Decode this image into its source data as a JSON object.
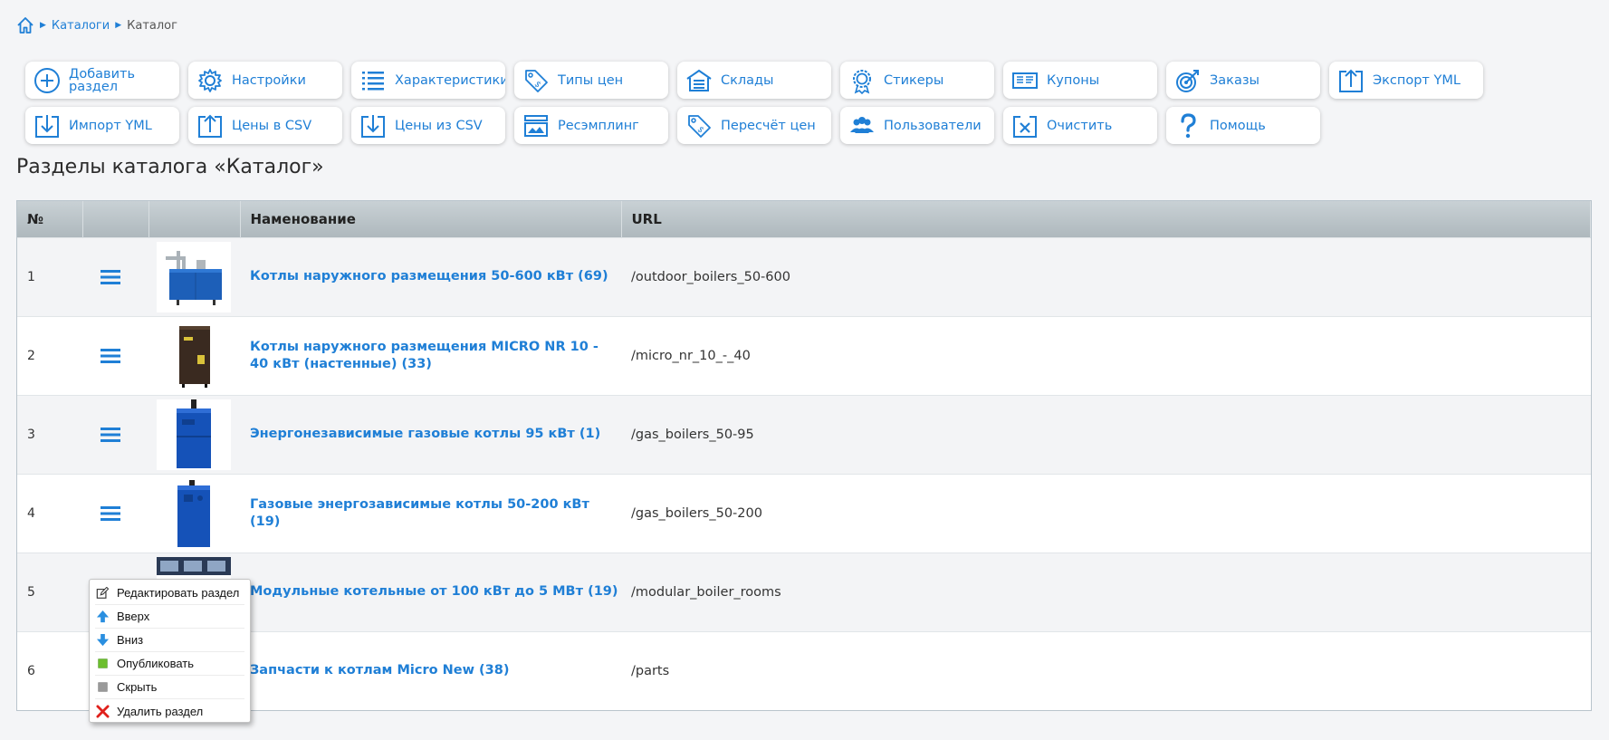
{
  "breadcrumb": {
    "items": [
      {
        "label": "Каталоги"
      },
      {
        "label": "Каталог"
      }
    ]
  },
  "toolbar": {
    "buttons": [
      {
        "label": "Добавить\nраздел",
        "icon": "plus-circle-icon"
      },
      {
        "label": "Настройки",
        "icon": "gear-icon"
      },
      {
        "label": "Характеристики",
        "icon": "list-icon"
      },
      {
        "label": "Типы цен",
        "icon": "price-tag-icon"
      },
      {
        "label": "Склады",
        "icon": "warehouse-icon"
      },
      {
        "label": "Стикеры",
        "icon": "badge-icon"
      },
      {
        "label": "Купоны",
        "icon": "coupon-icon"
      },
      {
        "label": "Заказы",
        "icon": "target-icon"
      },
      {
        "label": "Экспорт YML",
        "icon": "export-icon"
      },
      {
        "label": "Импорт YML",
        "icon": "import-icon"
      },
      {
        "label": "Цены в CSV",
        "icon": "upload-icon"
      },
      {
        "label": "Цены из CSV",
        "icon": "download-icon"
      },
      {
        "label": "Ресэмплинг",
        "icon": "resample-icon"
      },
      {
        "label": "Пересчёт цен",
        "icon": "price-recalc-icon"
      },
      {
        "label": "Пользователи",
        "icon": "users-icon"
      },
      {
        "label": "Очистить",
        "icon": "clear-icon"
      },
      {
        "label": "Помощь",
        "icon": "help-icon"
      }
    ]
  },
  "page_title": "Разделы каталога «Каталог»",
  "table": {
    "columns": [
      "№",
      "",
      "",
      "Наменование",
      "URL"
    ],
    "rows": [
      {
        "num": "1",
        "name": "Котлы наружного размещения 50-600 кВт (69)",
        "url": "/outdoor_boilers_50-600",
        "thumb": "boiler-outdoor"
      },
      {
        "num": "2",
        "name": "Котлы наружного размещения MICRO NR 10 - 40 кВт (настенные) (33)",
        "url": "/micro_nr_10_-_40",
        "thumb": "boiler-micro"
      },
      {
        "num": "3",
        "name": "Энергонезависимые газовые котлы 95 кВт (1)",
        "url": "/gas_boilers_50-95",
        "thumb": "boiler-blue"
      },
      {
        "num": "4",
        "name": "Газовые энергозависимые котлы 50-200 кВт (19)",
        "url": "/gas_boilers_50-200",
        "thumb": "boiler-blue2"
      },
      {
        "num": "5",
        "name": "Модульные котельные от 100 кВт до 5 МВт (19)",
        "url": "/modular_boiler_rooms",
        "thumb": "boiler-room"
      },
      {
        "num": "6",
        "name": "Запчасти к котлам Micro New (38)",
        "url": "/parts",
        "thumb": ""
      }
    ]
  },
  "context_menu": {
    "items": [
      {
        "label": "Редактировать раздел",
        "icon": "edit-icon"
      },
      {
        "label": "Вверх",
        "icon": "arrow-up-icon"
      },
      {
        "label": "Вниз",
        "icon": "arrow-down-icon"
      },
      {
        "label": "Опубликовать",
        "icon": "publish-square-icon"
      },
      {
        "label": "Скрыть",
        "icon": "hide-square-icon"
      },
      {
        "label": "Удалить раздел",
        "icon": "delete-x-icon"
      }
    ]
  },
  "colors": {
    "accent": "#1f7fd6",
    "publish": "#6cbf2d",
    "hide": "#9a9a9a",
    "delete": "#e0201b"
  }
}
